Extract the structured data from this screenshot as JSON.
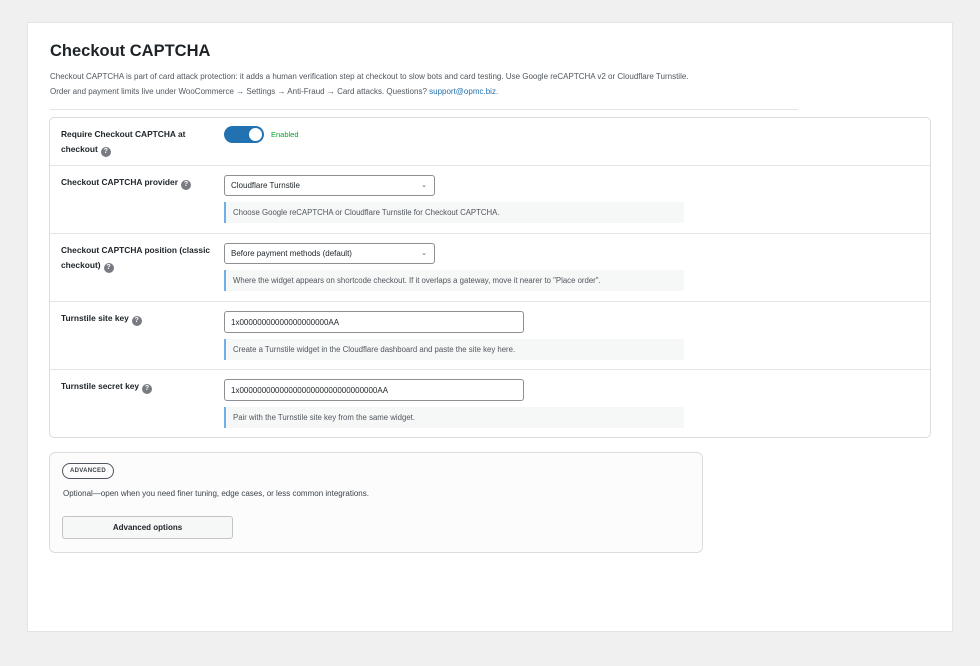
{
  "page": {
    "title": "Checkout CAPTCHA",
    "intro_line1": "Checkout CAPTCHA is part of card attack protection: it adds a human verification step at checkout to slow bots and card testing. Use Google reCAPTCHA v2 or Cloudflare Turnstile.",
    "intro_line2_prefix": "Order and payment limits live under WooCommerce → Settings → Anti-Fraud → Card attacks. Questions? ",
    "support_email": "support@opmc.biz",
    "intro_line2_suffix": "."
  },
  "settings": {
    "require": {
      "label": "Require Checkout CAPTCHA at checkout",
      "help_icon": "question-circle-icon",
      "toggle_on": true,
      "state_label": "Enabled"
    },
    "provider": {
      "label": "Checkout CAPTCHA provider",
      "help_icon": "question-circle-icon",
      "selected": "Cloudflare Turnstile",
      "hint": "Choose Google reCAPTCHA or Cloudflare Turnstile for Checkout CAPTCHA."
    },
    "position": {
      "label": "Checkout CAPTCHA position (classic checkout)",
      "help_icon": "question-circle-icon",
      "selected": "Before payment methods (default)",
      "hint": "Where the widget appears on shortcode checkout. If it overlaps a gateway, move it nearer to \"Place order\"."
    },
    "site_key": {
      "label": "Turnstile site key",
      "help_icon": "question-circle-icon",
      "value": "1x00000000000000000000AA",
      "hint": "Create a Turnstile widget in the Cloudflare dashboard and paste the site key here."
    },
    "secret_key": {
      "label": "Turnstile secret key",
      "help_icon": "question-circle-icon",
      "value": "1x0000000000000000000000000000000AA",
      "hint": "Pair with the Turnstile site key from the same widget."
    }
  },
  "advanced": {
    "badge": "ADVANCED",
    "description": "Optional—open when you need finer tuning, edge cases, or less common integrations.",
    "button_label": "Advanced options"
  },
  "colors": {
    "accent": "#2271b1",
    "enabled_text": "#00a32a",
    "hint_border": "#72aee6"
  }
}
